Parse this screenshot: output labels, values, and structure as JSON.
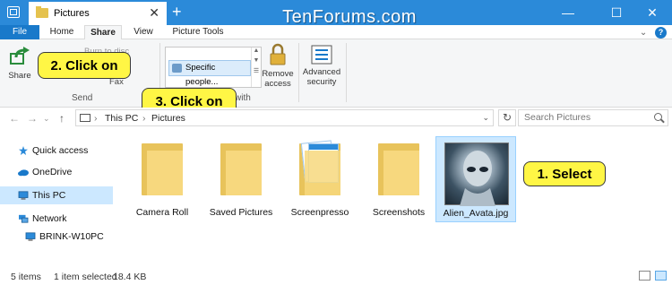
{
  "window": {
    "tab_title": "Pictures",
    "tab_close": "✕",
    "new_tab": "+",
    "watermark": "TenForums.com",
    "controls": {
      "minimize": "—",
      "maximize": "☐",
      "close": "✕"
    }
  },
  "ribbon": {
    "tabs": [
      "File",
      "Home",
      "Share",
      "View",
      "Picture Tools"
    ],
    "active_tab": "Share",
    "help": "?",
    "share_group": {
      "share_label": "Share",
      "email_label": "Burn to disc",
      "fax_label": "Fax",
      "group_label": "Send"
    },
    "share_with": {
      "item": "Specific people...",
      "group_label": "with"
    },
    "remove_access_label": "Remove access",
    "advanced_security_label": "Advanced security"
  },
  "callouts": {
    "step1": "1. Select",
    "step2": "2. Click on",
    "step3": "3. Click on"
  },
  "address": {
    "crumbs": [
      "This PC",
      "Pictures"
    ],
    "search_placeholder": "Search Pictures"
  },
  "nav_pane": {
    "items": [
      {
        "label": "Quick access"
      },
      {
        "label": "OneDrive"
      },
      {
        "label": "This PC"
      },
      {
        "label": "Network"
      },
      {
        "label": "BRINK-W10PC"
      }
    ]
  },
  "files": [
    {
      "name": "Camera Roll"
    },
    {
      "name": "Saved Pictures"
    },
    {
      "name": "Screenpresso"
    },
    {
      "name": "Screenshots"
    },
    {
      "name": "Alien_Avata.jpg"
    }
  ],
  "status": {
    "item_count": "5 items",
    "selection": "1 item selected",
    "size": "18.4 KB"
  },
  "colors": {
    "titlebar": "#2b8ad9",
    "file_tab": "#1979ca",
    "callout": "#fff645",
    "selected": "#cce8ff"
  }
}
